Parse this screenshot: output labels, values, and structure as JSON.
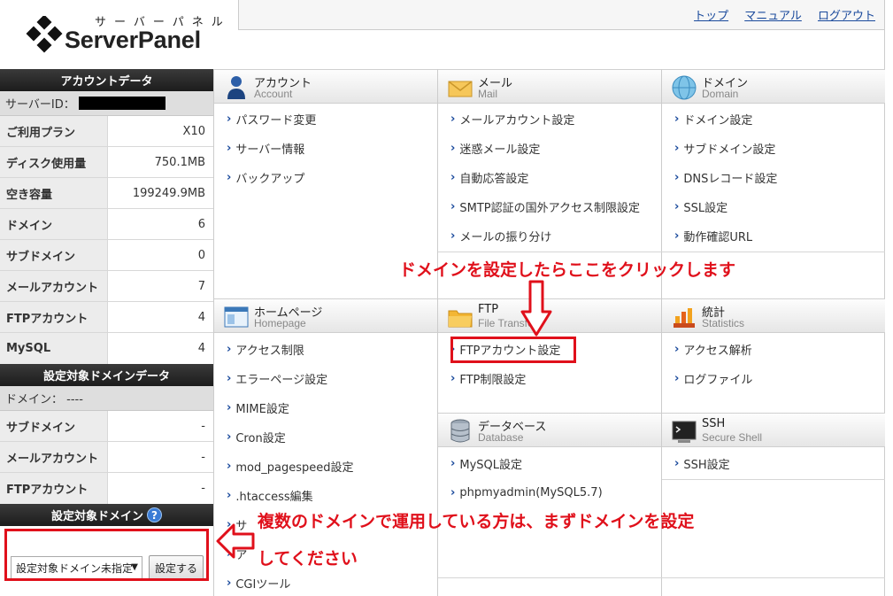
{
  "logo": {
    "kana": "サーバーパネル",
    "name": "ServerPanel"
  },
  "toplinks": [
    "トップ",
    "マニュアル",
    "ログアウト"
  ],
  "account_data": {
    "title": "アカウントデータ",
    "server_id_label": "サーバーID：",
    "rows": [
      {
        "label": "ご利用プラン",
        "value": "X10"
      },
      {
        "label": "ディスク使用量",
        "value": "750.1MB"
      },
      {
        "label": "空き容量",
        "value": "199249.9MB"
      },
      {
        "label": "ドメイン",
        "value": "6"
      },
      {
        "label": "サブドメイン",
        "value": "0"
      },
      {
        "label": "メールアカウント",
        "value": "7"
      },
      {
        "label": "FTPアカウント",
        "value": "4"
      },
      {
        "label": "MySQL",
        "value": "4"
      }
    ]
  },
  "target_domain_data": {
    "title": "設定対象ドメインデータ",
    "domain_label": "ドメイン：  ----",
    "rows": [
      {
        "label": "サブドメイン",
        "value": "-"
      },
      {
        "label": "メールアカウント",
        "value": "-"
      },
      {
        "label": "FTPアカウント",
        "value": "-"
      }
    ]
  },
  "target_domain": {
    "title": "設定対象ドメイン",
    "help": "?",
    "select_value": "設定対象ドメイン未指定",
    "button": "設定する"
  },
  "sections": {
    "account": {
      "title": "アカウント",
      "sub": "Account",
      "items": [
        "パスワード変更",
        "サーバー情報",
        "バックアップ"
      ]
    },
    "mail": {
      "title": "メール",
      "sub": "Mail",
      "items": [
        "メールアカウント設定",
        "迷惑メール設定",
        "自動応答設定",
        "SMTP認証の国外アクセス制限設定",
        "メールの振り分け"
      ]
    },
    "domain": {
      "title": "ドメイン",
      "sub": "Domain",
      "items": [
        "ドメイン設定",
        "サブドメイン設定",
        "DNSレコード設定",
        "SSL設定",
        "動作確認URL"
      ]
    },
    "homepage": {
      "title": "ホームページ",
      "sub": "Homepage",
      "items": [
        "アクセス制限",
        "エラーページ設定",
        "MIME設定",
        "Cron設定",
        "mod_pagespeed設定",
        ".htaccess編集",
        "サ",
        "ア",
        "CGIツール"
      ]
    },
    "ftp": {
      "title": "FTP",
      "sub": "File Transfer",
      "items": [
        "FTPアカウント設定",
        "FTP制限設定"
      ]
    },
    "stats": {
      "title": "統計",
      "sub": "Statistics",
      "items": [
        "アクセス解析",
        "ログファイル"
      ]
    },
    "database": {
      "title": "データベース",
      "sub": "Database",
      "items": [
        "MySQL設定",
        "phpmyadmin(MySQL5.7)"
      ]
    },
    "ssh": {
      "title": "SSH",
      "sub": "Secure Shell",
      "items": [
        "SSH設定"
      ]
    }
  },
  "annotations": {
    "top": "ドメインを設定したらここをクリックします",
    "bottom_line1": "複数のドメインで運用している方は、まずドメインを設定",
    "bottom_line2": "してください",
    "color": "#e0101b"
  }
}
